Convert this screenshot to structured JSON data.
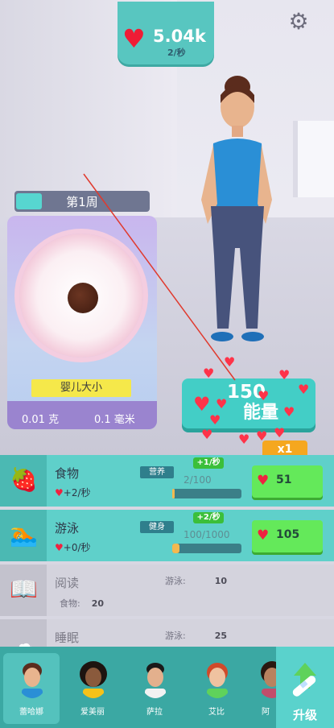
{
  "top_counter": {
    "value": "5.04k",
    "rate": "2/秒",
    "icon": "heart-icon"
  },
  "settings_icon": "gear-icon",
  "week": {
    "label": "第1周",
    "progress": 0.2
  },
  "baby_card": {
    "ruler_label": "婴儿大小",
    "weight": "0.01 克",
    "length": "0.1 毫米"
  },
  "energy_button": {
    "value": "150",
    "label": "能量"
  },
  "multiplier": "x1",
  "activities": [
    {
      "name": "食物",
      "rate": "+2/秒",
      "tag": "营养",
      "plus": "+1/秒",
      "progress": "2/100",
      "progress_fraction": 0.02,
      "cost": "51",
      "icon": "strawberry-icon"
    },
    {
      "name": "游泳",
      "rate": "+0/秒",
      "tag": "健身",
      "plus": "+2/秒",
      "progress": "100/1000",
      "progress_fraction": 0.1,
      "cost": "105",
      "icon": "swimmer-icon"
    },
    {
      "name": "阅读",
      "req_label_1": "游泳:",
      "req_value_1": "10",
      "req_label_2": "食物:",
      "req_value_2": "20",
      "icon": "book-icon"
    },
    {
      "name": "睡眠",
      "req_label_1": "游泳:",
      "req_value_1": "25",
      "icon": "pillow-icon"
    }
  ],
  "characters": [
    {
      "name": "蕾哈娜",
      "hair": "#5b2c1d",
      "shirt": "#2a8fd6",
      "skin": "#e8b48e"
    },
    {
      "name": "爱美丽",
      "hair": "#1d1410",
      "shirt": "#f6c218",
      "skin": "#8a5a3c"
    },
    {
      "name": "萨拉",
      "hair": "#1a1a1a",
      "shirt": "#f2f2f2",
      "skin": "#e3b08d"
    },
    {
      "name": "艾比",
      "hair": "#d04a2a",
      "shirt": "#5fd25b",
      "skin": "#efc2a0"
    },
    {
      "name": "阿",
      "hair": "#2a1810",
      "shirt": "#c24d6b",
      "skin": "#b9825f"
    }
  ],
  "upgrade": {
    "label": "升级",
    "icon": "pregnancy-test-icon"
  }
}
